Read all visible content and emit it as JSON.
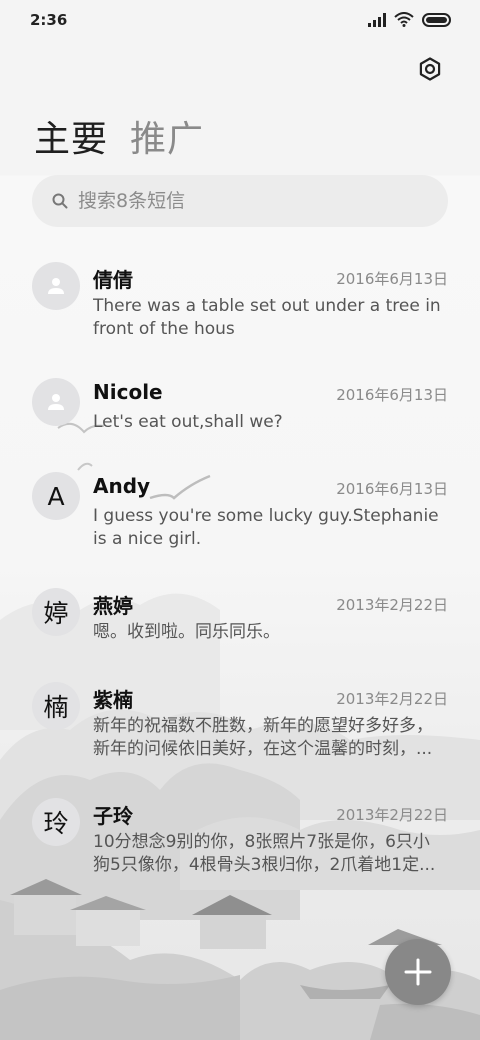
{
  "status_bar": {
    "time": "2:36"
  },
  "header": {
    "tabs": [
      {
        "label": "主要",
        "active": true
      },
      {
        "label": "推广",
        "active": false
      }
    ]
  },
  "search": {
    "placeholder": "搜索8条短信"
  },
  "conversations": [
    {
      "avatar": "",
      "avatar_type": "person-icon",
      "name": "倩倩",
      "date": "2016年6月13日",
      "preview_lines": [
        "There was a table set out under a tree in",
        "front of the hous"
      ]
    },
    {
      "avatar": "",
      "avatar_type": "person-icon",
      "name": "Nicole",
      "date": "2016年6月13日",
      "preview_lines": [
        "Let's eat out,shall we?"
      ]
    },
    {
      "avatar": "A",
      "avatar_type": "letter",
      "name": "Andy",
      "date": "2016年6月13日",
      "preview_lines": [
        "I guess you're some lucky guy.Stephanie",
        "is a nice girl."
      ]
    },
    {
      "avatar": "婷",
      "avatar_type": "letter",
      "name": "燕婷",
      "date": "2013年2月22日",
      "preview_lines": [
        "嗯。收到啦。同乐同乐。"
      ]
    },
    {
      "avatar": "楠",
      "avatar_type": "letter",
      "name": "紫楠",
      "date": "2013年2月22日",
      "preview_lines": [
        "新年的祝福数不胜数，新年的愿望好多好多，",
        "新年的问候依旧美好，在这个温馨的时刻，..."
      ]
    },
    {
      "avatar": "玲",
      "avatar_type": "letter",
      "name": "子玲",
      "date": "2013年2月22日",
      "preview_lines": [
        "10分想念9别的你，8张照片7张是你，6只小",
        "狗5只像你，4根骨头3根归你，2爪着地1定..."
      ]
    }
  ],
  "fab": {
    "icon": "plus-icon"
  },
  "colors": {
    "fab_bg": "#888888",
    "avatar_bg": "#e2e2e4",
    "date_text": "#8a8a8a"
  }
}
